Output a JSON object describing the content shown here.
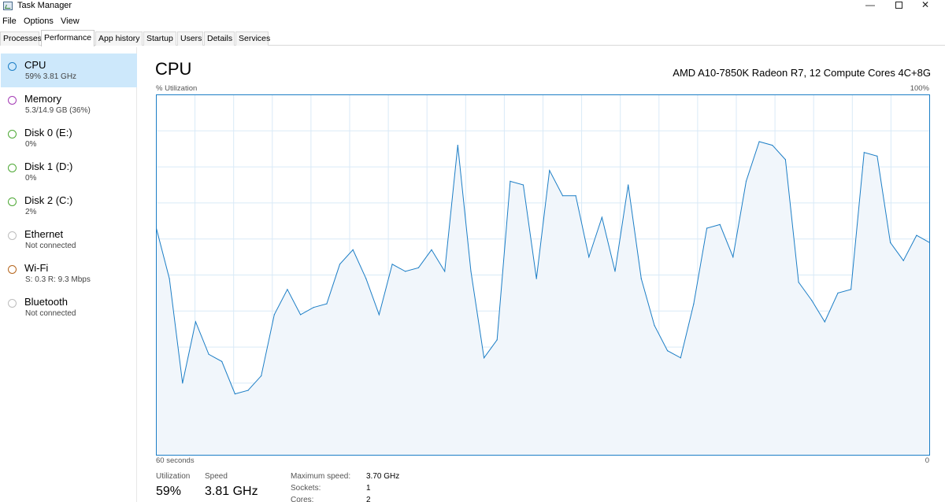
{
  "window": {
    "title": "Task Manager",
    "controls": {
      "minimize": "—",
      "close": "✕"
    }
  },
  "menu": [
    "File",
    "Options",
    "View"
  ],
  "tabs": [
    "Processes",
    "Performance",
    "App history",
    "Startup",
    "Users",
    "Details",
    "Services"
  ],
  "active_tab": "Performance",
  "sidebar": {
    "items": [
      {
        "name": "CPU",
        "sub": "59%  3.81 GHz",
        "color": "#1c7ec6",
        "selected": true
      },
      {
        "name": "Memory",
        "sub": "5.3/14.9 GB (36%)",
        "color": "#a43bb5",
        "selected": false
      },
      {
        "name": "Disk 0 (E:)",
        "sub": "0%",
        "color": "#4da834",
        "selected": false
      },
      {
        "name": "Disk 1 (D:)",
        "sub": "0%",
        "color": "#4da834",
        "selected": false
      },
      {
        "name": "Disk 2 (C:)",
        "sub": "2%",
        "color": "#4da834",
        "selected": false
      },
      {
        "name": "Ethernet",
        "sub": "Not connected",
        "color": "#bdbdbd",
        "selected": false
      },
      {
        "name": "Wi-Fi",
        "sub": "S: 0.3  R: 9.3 Mbps",
        "color": "#b5651d",
        "selected": false
      },
      {
        "name": "Bluetooth",
        "sub": "Not connected",
        "color": "#bdbdbd",
        "selected": false
      }
    ]
  },
  "main": {
    "title": "CPU",
    "cpu_model": "AMD A10-7850K Radeon R7, 12 Compute Cores 4C+8G",
    "y_label": "% Utilization",
    "y_max_label": "100%",
    "x_left_label": "60 seconds",
    "x_right_label": "0"
  },
  "stats": {
    "utilization_label": "Utilization",
    "utilization_value": "59%",
    "speed_label": "Speed",
    "speed_value": "3.81 GHz"
  },
  "specs": [
    {
      "label": "Maximum speed:",
      "value": "3.70 GHz"
    },
    {
      "label": "Sockets:",
      "value": "1"
    },
    {
      "label": "Cores:",
      "value": "2"
    }
  ],
  "chart_data": {
    "type": "area",
    "ylabel": "% Utilization",
    "ylim": [
      0,
      100
    ],
    "xlim": [
      60,
      0
    ],
    "grid": true,
    "color": "#1c7ec6",
    "fill": "#f1f6fb",
    "y": [
      63,
      49,
      20,
      37,
      28,
      26,
      17,
      18,
      22,
      39,
      46,
      39,
      41,
      42,
      53,
      57,
      49,
      39,
      53,
      51,
      52,
      57,
      51,
      86,
      51,
      27,
      32,
      76,
      75,
      49,
      79,
      72,
      72,
      55,
      66,
      51,
      75,
      49,
      36,
      29,
      27,
      42,
      63,
      64,
      55,
      76,
      87,
      86,
      82,
      48,
      43,
      37,
      45,
      46,
      84,
      83,
      59,
      54,
      61,
      59
    ]
  }
}
